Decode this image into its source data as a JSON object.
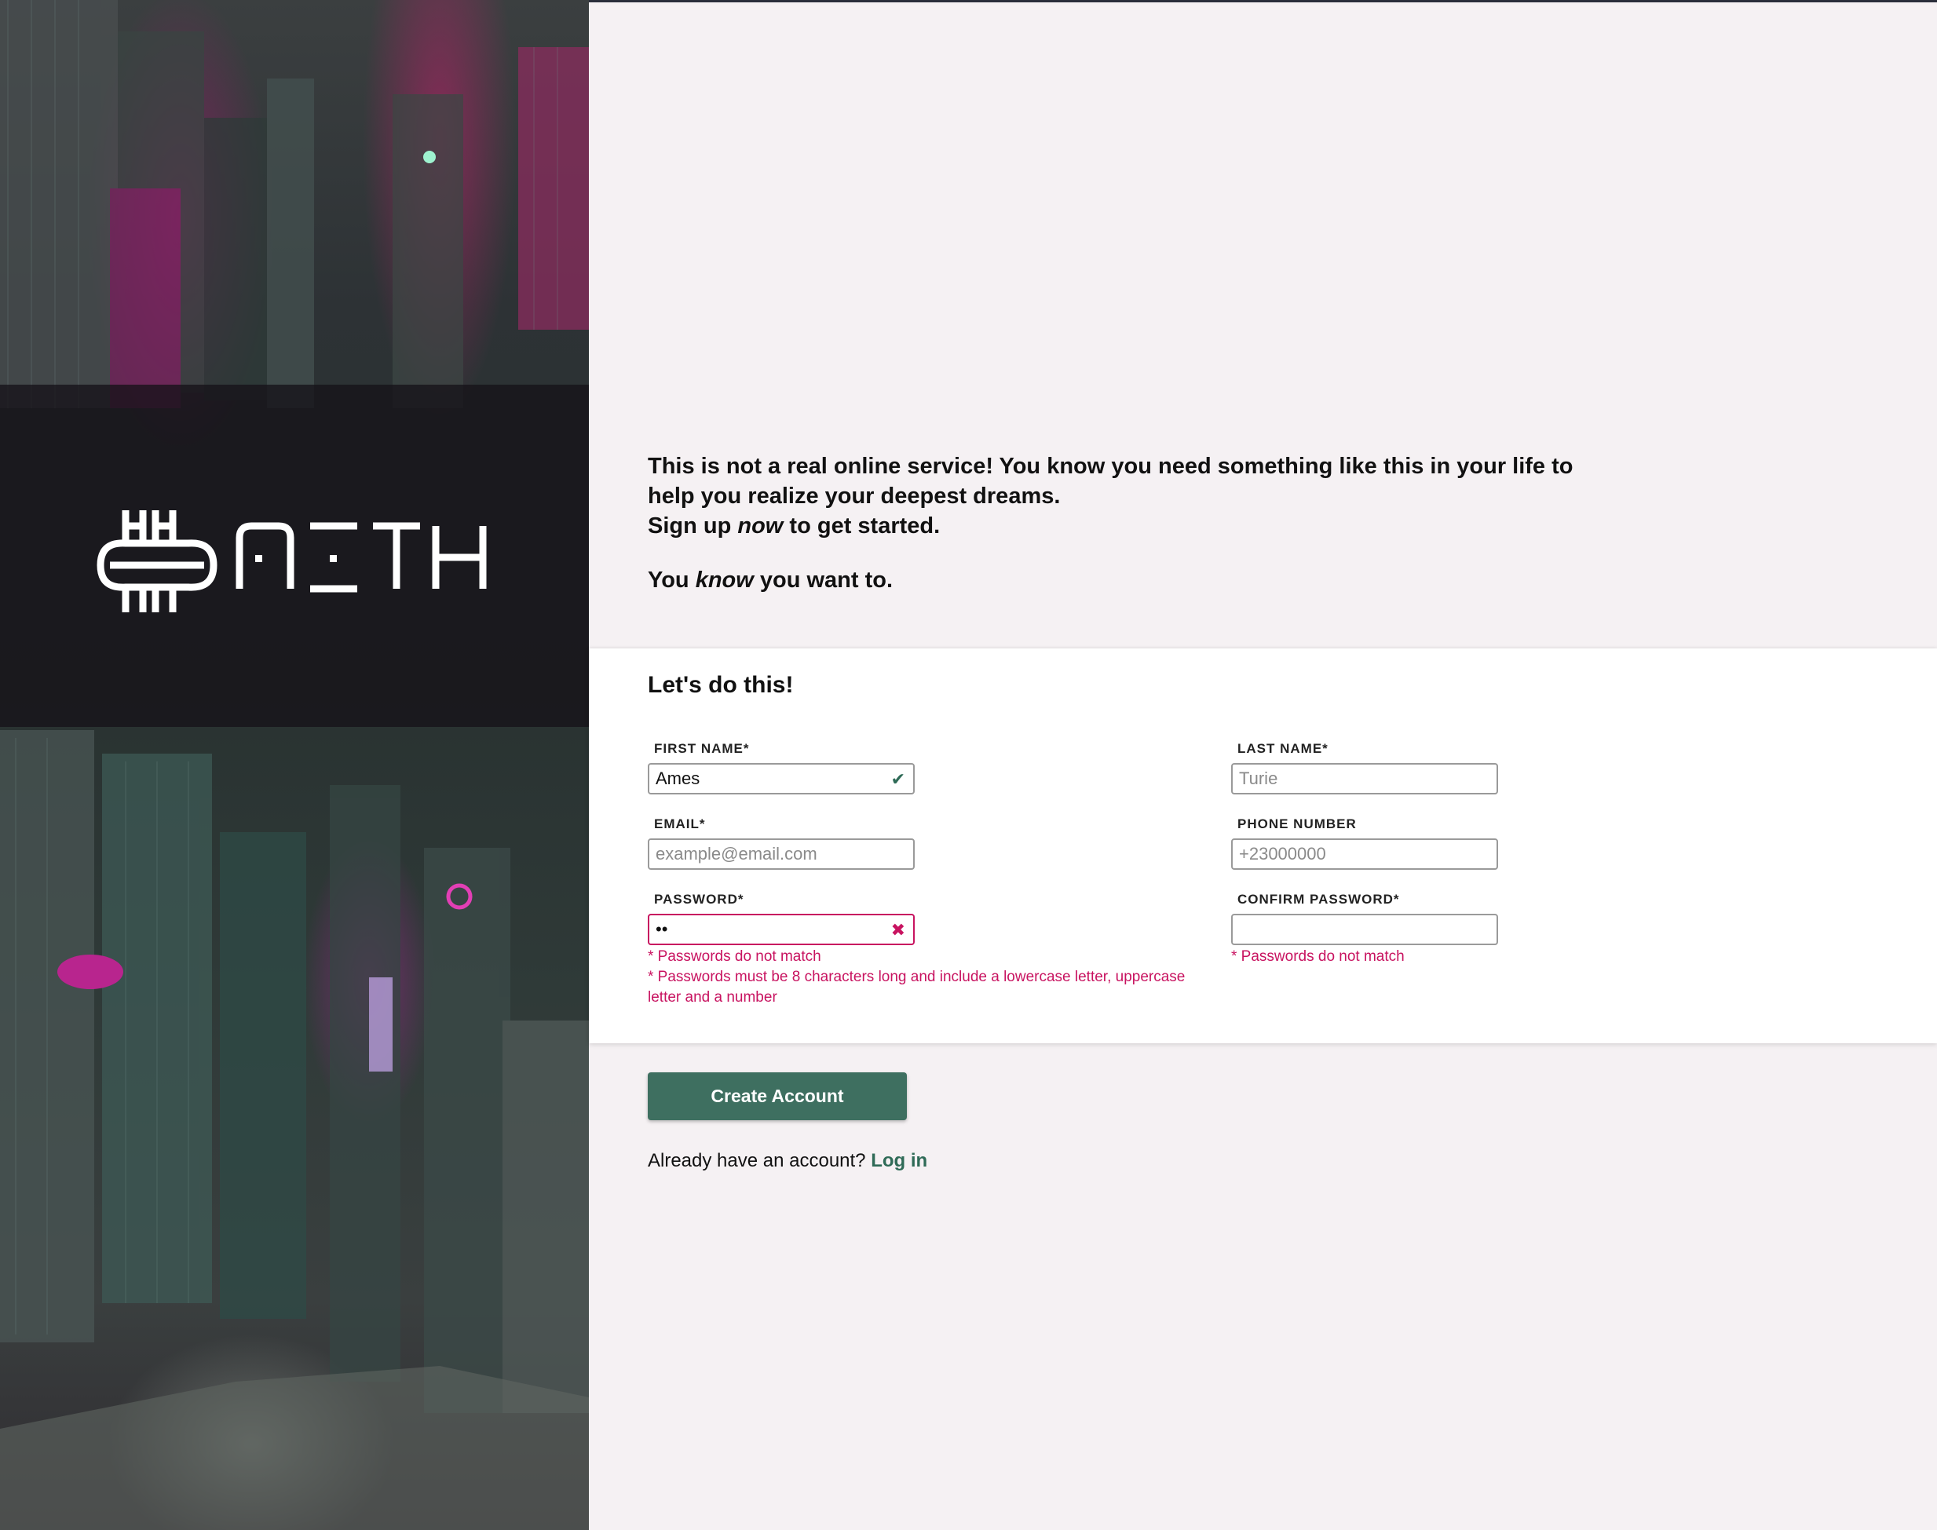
{
  "brand": {
    "name": "AETH"
  },
  "intro": {
    "line1": "This is not a real online service! You know you need something like this in your life to help you realize your deepest dreams.",
    "line2_pre": "Sign up ",
    "line2_em": "now",
    "line2_post": " to get started.",
    "line3_pre": "You ",
    "line3_em": "know",
    "line3_post": " you want to."
  },
  "form": {
    "title": "Let's do this!",
    "first_name": {
      "label": "FIRST NAME*",
      "value": "Ames",
      "placeholder": "",
      "status": "valid"
    },
    "last_name": {
      "label": "LAST NAME*",
      "value": "",
      "placeholder": "Turie"
    },
    "email": {
      "label": "EMAIL*",
      "value": "",
      "placeholder": "example@email.com"
    },
    "phone": {
      "label": "PHONE NUMBER",
      "value": "",
      "placeholder": "+23000000"
    },
    "password": {
      "label": "PASSWORD*",
      "value": "••",
      "status": "invalid",
      "errors": [
        "* Passwords do not match",
        "* Passwords must be 8 characters long and include a lowercase letter, uppercase letter and a number"
      ]
    },
    "confirm_password": {
      "label": "CONFIRM PASSWORD*",
      "value": "",
      "errors": [
        "* Passwords do not match"
      ]
    },
    "status_icons": {
      "valid": "✔",
      "invalid": "✖"
    }
  },
  "actions": {
    "create_label": "Create Account",
    "login_prompt": "Already have an account?",
    "login_link": "Log in"
  },
  "colors": {
    "accent": "#3e6f60",
    "error": "#c81360",
    "background": "#f5f1f3"
  }
}
